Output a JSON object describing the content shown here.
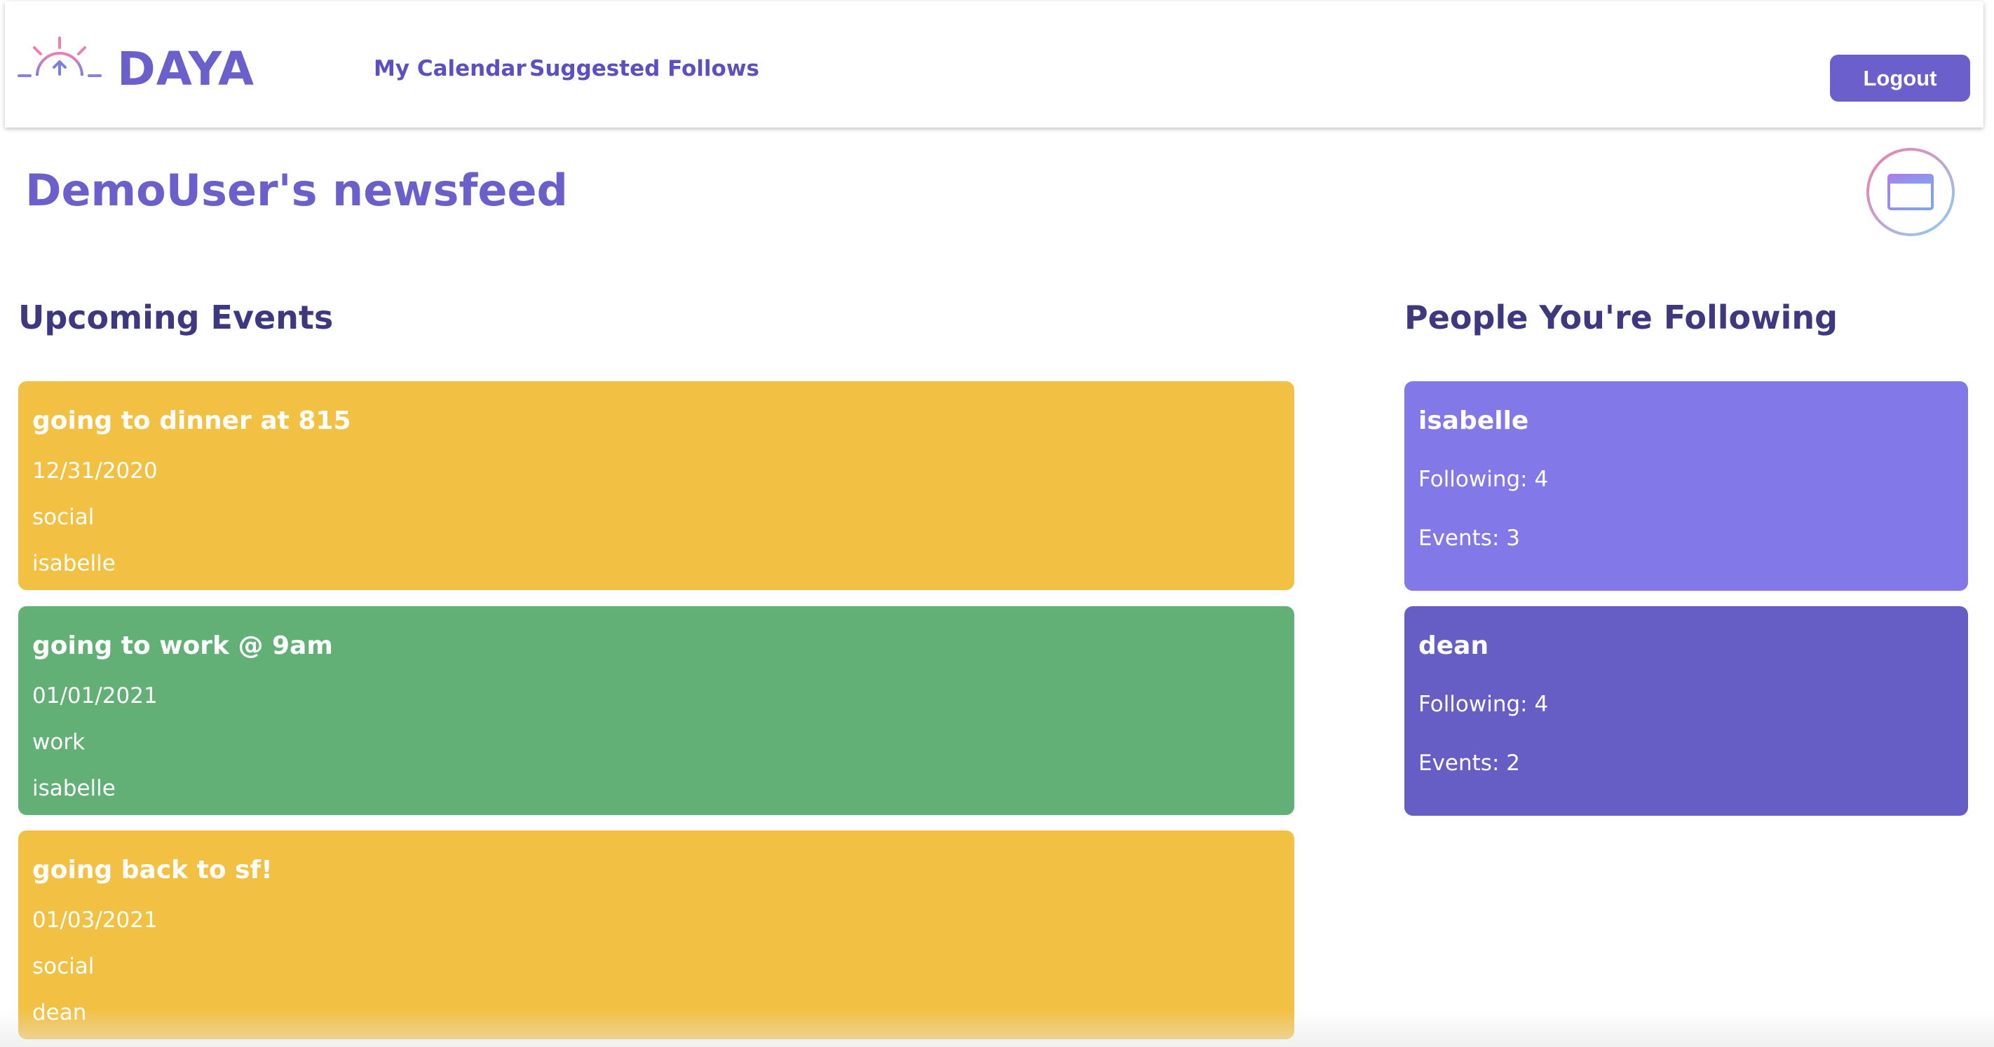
{
  "header": {
    "brand": "DAYA",
    "nav": {
      "my_calendar": "My Calendar",
      "suggested_follows": "Suggested Follows"
    },
    "logout_label": "Logout"
  },
  "page_title": "DemoUser's newsfeed",
  "sections": {
    "events_heading": "Upcoming Events",
    "following_heading": "People You're Following"
  },
  "events": [
    {
      "title": "going to dinner at 815",
      "date": "12/31/2020",
      "category": "social",
      "user": "isabelle",
      "color": "#f2c143"
    },
    {
      "title": "going to work @ 9am",
      "date": "01/01/2021",
      "category": "work",
      "user": "isabelle",
      "color": "#63b077"
    },
    {
      "title": "going back to sf!",
      "date": "01/03/2021",
      "category": "social",
      "user": "dean",
      "color": "#f2c143"
    }
  ],
  "following": [
    {
      "name": "isabelle",
      "following": "Following: 4",
      "events": "Events: 3",
      "color": "#8378e8"
    },
    {
      "name": "dean",
      "following": "Following: 4",
      "events": "Events: 2",
      "color": "#665ec4"
    }
  ],
  "colors": {
    "accent": "#6a5fcb",
    "heading": "#3e3880",
    "social": "#f2c143",
    "work": "#63b077"
  }
}
